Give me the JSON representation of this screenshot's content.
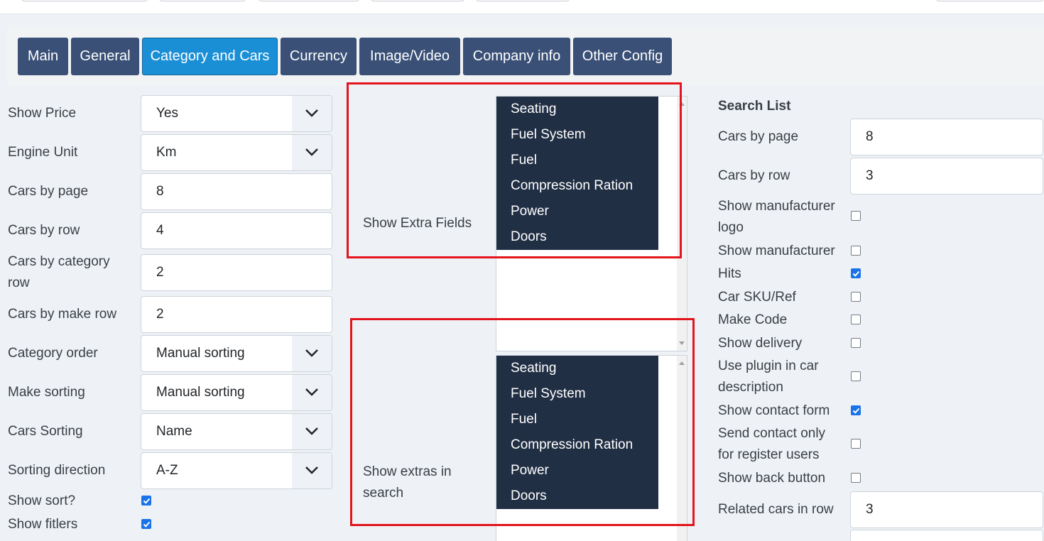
{
  "tabs": [
    "Main",
    "General",
    "Category and Cars",
    "Currency",
    "Image/Video",
    "Company info",
    "Other Config"
  ],
  "left_form": {
    "show_price": {
      "label": "Show Price",
      "value": "Yes"
    },
    "engine_unit": {
      "label": "Engine Unit",
      "value": "Km"
    },
    "cars_by_page": {
      "label": "Cars by page",
      "value": "8"
    },
    "cars_by_row": {
      "label": "Cars by row",
      "value": "4"
    },
    "cars_by_category_row": {
      "label_line1": "Cars by category",
      "label_line2": "row",
      "value": "2"
    },
    "cars_by_make_row": {
      "label": "Cars by make row",
      "value": "2"
    },
    "category_order": {
      "label": "Category order",
      "value": "Manual sorting"
    },
    "make_sorting": {
      "label": "Make sorting",
      "value": "Manual sorting"
    },
    "cars_sorting": {
      "label": "Cars Sorting",
      "value": "Name"
    },
    "sorting_direction": {
      "label": "Sorting direction",
      "value": "A-Z"
    },
    "show_sort": {
      "label": "Show sort?",
      "checked": true
    },
    "show_filters": {
      "label": "Show fitlers",
      "checked": true
    }
  },
  "extra_fields": {
    "label": "Show Extra Fields",
    "options": [
      "Seating",
      "Fuel System",
      "Fuel",
      "Compression Ration",
      "Power",
      "Doors"
    ]
  },
  "extras_in_search": {
    "label_line1": "Show extras in",
    "label_line2": "search",
    "options": [
      "Seating",
      "Fuel System",
      "Fuel",
      "Compression Ration",
      "Power",
      "Doors"
    ]
  },
  "search_list": {
    "heading": "Search List",
    "cars_by_page": {
      "label": "Cars by page",
      "value": "8"
    },
    "cars_by_row": {
      "label": "Cars by row",
      "value": "3"
    },
    "show_manufacturer_logo": {
      "label_line1": "Show manufacturer",
      "label_line2": "logo",
      "checked": false
    },
    "show_manufacturer": {
      "label": "Show manufacturer",
      "checked": false
    },
    "hits": {
      "label": "Hits",
      "checked": true
    },
    "car_sku": {
      "label": "Car SKU/Ref",
      "checked": false
    },
    "make_code": {
      "label": "Make Code",
      "checked": false
    },
    "show_delivery": {
      "label": "Show delivery",
      "checked": false
    },
    "use_plugin": {
      "label_line1": "Use plugin in car",
      "label_line2": "description",
      "checked": false
    },
    "show_contact_form": {
      "label": "Show contact form",
      "checked": true
    },
    "send_contact_only": {
      "label_line1": "Send contact only",
      "label_line2": "for register users",
      "checked": false
    },
    "show_back_button": {
      "label": "Show back button",
      "checked": false
    },
    "related_cars_in_row": {
      "label": "Related cars in row",
      "value": "3"
    }
  },
  "colors": {
    "accent": "#1a8fd6",
    "tab": "#3a5077",
    "selected_option": "#212f45",
    "checkbox": "#1a73e8",
    "highlight": "#e3141c"
  }
}
